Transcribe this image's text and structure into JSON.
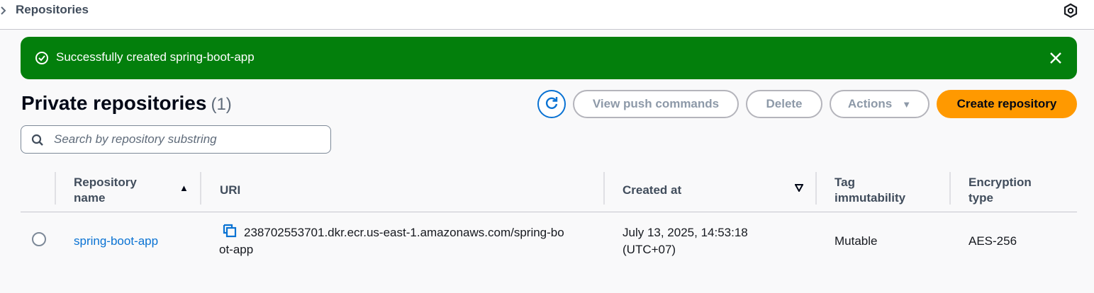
{
  "breadcrumb": {
    "label": "Repositories"
  },
  "flash": {
    "message": "Successfully created spring-boot-app"
  },
  "header": {
    "title": "Private repositories",
    "count": "(1)"
  },
  "buttons": {
    "view_push_commands": "View push commands",
    "delete": "Delete",
    "actions": "Actions",
    "create_repository": "Create repository"
  },
  "search": {
    "placeholder": "Search by repository substring",
    "value": ""
  },
  "table": {
    "columns": {
      "repository_name": "Repository name",
      "uri": "URI",
      "created_at": "Created at",
      "tag_immutability": "Tag immutability",
      "encryption_type": "Encryption type"
    },
    "rows": [
      {
        "repository_name": "spring-boot-app",
        "uri_line1": "238702553701.dkr.ecr.us-east-1.amazonaws.com/spring-bo",
        "uri_line2": "ot-app",
        "created_at_line1": "July 13, 2025, 14:53:18",
        "created_at_line2": "(UTC+07)",
        "tag_immutability": "Mutable",
        "encryption_type": "AES-256"
      }
    ]
  },
  "colors": {
    "success": "#037f0c",
    "primary_button": "#ff9900",
    "link": "#0972d3"
  },
  "icons": {
    "breadcrumb": "chevron-right-icon",
    "corner": "hexagon-settings-icon",
    "flash": "success-check-circle-icon",
    "close": "close-icon",
    "refresh": "refresh-icon",
    "actions_caret": "caret-down-icon",
    "search": "search-icon",
    "sort_name": "sort-ascending-icon",
    "sort_created": "sort-descending-icon",
    "copy": "copy-icon"
  }
}
